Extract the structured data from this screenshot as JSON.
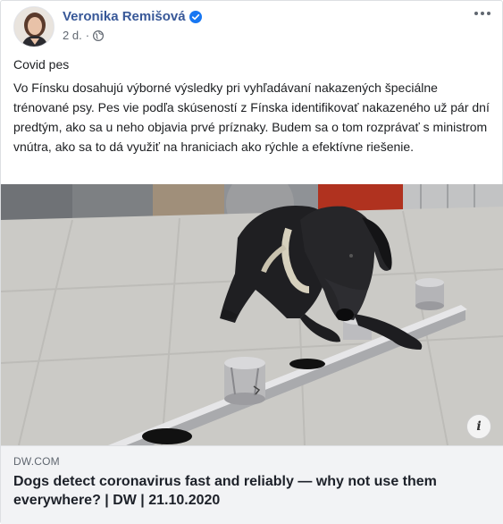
{
  "post": {
    "author": "Veronika Remišová",
    "verified_icon": "verified-badge-icon",
    "time": "2 d.",
    "separator": "·",
    "privacy_icon": "globe-icon",
    "more_icon": "more-options-icon",
    "title": "Covid pes",
    "text": "Vo Fínsku dosahujú výborné výsledky pri vyhľadávaní nakazených špeciálne trénované psy. Pes vie podľa skúseností z Fínska identifikovať nakazeného už pár dní predtým, ako sa u neho objavia prvé príznaky. Budem sa o tom rozprávať s ministrom vnútra, ako sa to dá využiť na hraniciach ako rýchle a efektívne riešenie."
  },
  "link": {
    "domain": "DW.COM",
    "title": "Dogs detect coronavirus fast and reliably — why not use them everywhere? | DW | 21.10.2020",
    "info_label": "i",
    "image_description_icon": "dog-photo"
  },
  "colors": {
    "author": "#385898",
    "verified": "#1877f2",
    "link_bg": "#f2f3f5"
  }
}
